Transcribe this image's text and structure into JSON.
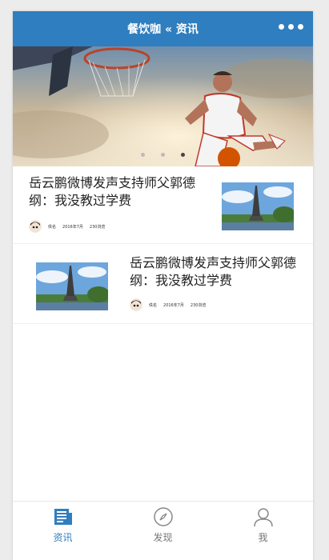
{
  "nav": {
    "title": "餐饮咖 « 资讯"
  },
  "banner": {
    "dots": 3,
    "active_dot": 2
  },
  "articles": [
    {
      "title": "岳云鹏微博发声支持师父郭德纲：我没教过学费",
      "author": "佚名",
      "date": "2016年7月",
      "views": "230浏览"
    },
    {
      "title": "岳云鹏微博发声支持师父郭德纲：我没教过学费",
      "author": "佚名",
      "date": "2016年7月",
      "views": "230浏览"
    }
  ],
  "tabs": [
    {
      "label": "资讯",
      "icon": "news-icon",
      "active": true
    },
    {
      "label": "发现",
      "icon": "compass-icon",
      "active": false
    },
    {
      "label": "我",
      "icon": "user-icon",
      "active": false
    }
  ],
  "colors": {
    "primary": "#2f7ebf"
  }
}
